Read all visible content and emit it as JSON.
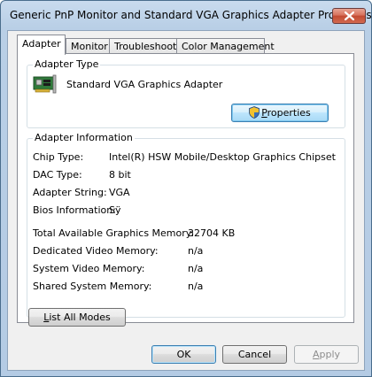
{
  "window": {
    "title": "Generic PnP Monitor and Standard VGA Graphics Adapter Properties"
  },
  "tabs": [
    {
      "label": "Adapter",
      "active": true
    },
    {
      "label": "Monitor",
      "active": false
    },
    {
      "label": "Troubleshoot",
      "active": false
    },
    {
      "label": "Color Management",
      "active": false
    }
  ],
  "adapter_type": {
    "group_label": "Adapter Type",
    "name": "Standard VGA Graphics Adapter",
    "properties_button": {
      "prefix": "",
      "accel": "P",
      "rest": "roperties"
    }
  },
  "adapter_info": {
    "group_label": "Adapter Information",
    "rows": [
      {
        "label": "Chip Type:",
        "value": "Intel(R) HSW Mobile/Desktop Graphics Chipset"
      },
      {
        "label": "DAC Type:",
        "value": "8 bit"
      },
      {
        "label": "Adapter String:",
        "value": "VGA"
      },
      {
        "label": "Bios Information:",
        "value": "Sÿ"
      }
    ],
    "memory": [
      {
        "label": "Total Available Graphics Memory:",
        "value": "32704 KB"
      },
      {
        "label": "Dedicated Video Memory:",
        "value": "n/a"
      },
      {
        "label": "System Video Memory:",
        "value": "n/a"
      },
      {
        "label": "Shared System Memory:",
        "value": "n/a"
      }
    ]
  },
  "list_all_modes_button": {
    "accel": "L",
    "rest": "ist All Modes"
  },
  "footer": {
    "ok_label": "OK",
    "cancel_label": "Cancel",
    "apply_accel": "A",
    "apply_rest": "pply"
  },
  "colors": {
    "title_bar": "#b9cfe6",
    "close_button": "#c24a32",
    "focus_border": "#3c7fb1"
  },
  "icons": {
    "close": "close-icon",
    "adapter": "graphics-card-icon",
    "shield": "uac-shield-icon"
  }
}
